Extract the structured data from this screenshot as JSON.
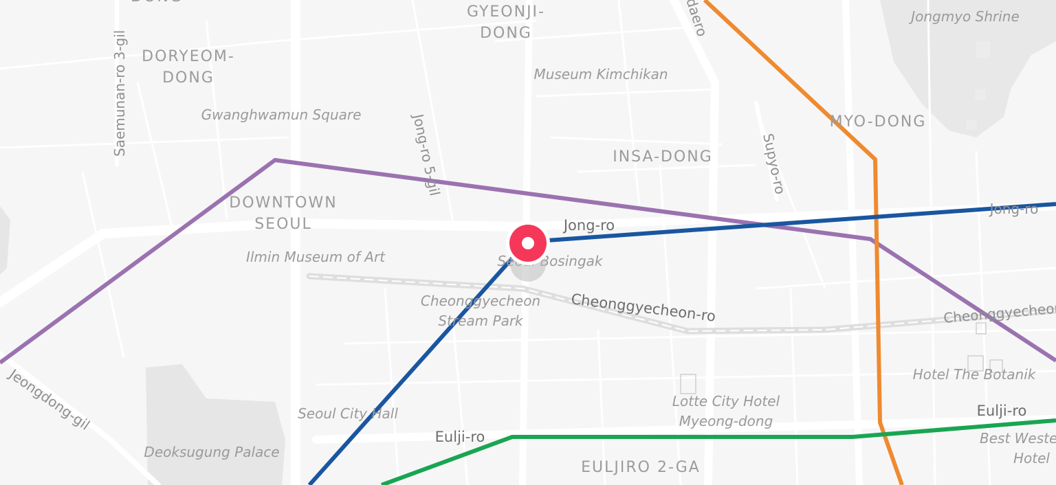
{
  "map": {
    "districts": {
      "gyeonji_1": "GYEONJI-",
      "gyeonji_2": "DONG",
      "doryeom_1": "DORYEOM-",
      "doryeom_2": "DONG",
      "downtown_1": "DOWNTOWN",
      "downtown_2": "SEOUL",
      "insa": "INSA-DONG",
      "myo": "MYO-DONG",
      "euljiro2ga": "EULJIRO 2-GA",
      "dong_top": "DONG"
    },
    "pois": {
      "jongmyo": "Jongmyo Shrine",
      "kimchikan": "Museum Kimchikan",
      "gwanghwamun": "Gwanghwamun Square",
      "ilmin": "Ilmin Museum of Art",
      "bosingak": "Seoul Bosingak",
      "cheonggye_1": "Cheonggyecheon",
      "cheonggye_2": "Stream Park",
      "botanik": "Hotel The Botanik",
      "lotte_1": "Lotte City Hotel",
      "lotte_2": "Myeong-dong",
      "cityhall": "Seoul City Hall",
      "deoksugung": "Deoksugung Palace",
      "bestwestern_1": "Best Western",
      "bestwestern_2": "Hotel"
    },
    "roads": {
      "saemunan": "Saemunan-ro 3-gil",
      "jongro5gil": "Jong-ro 5-gil",
      "supyo": "Supyo-ro",
      "daero": "daero",
      "jongro_main": "Jong-ro",
      "jongro_east": "Jong-ro",
      "cheonggye_ro": "Cheonggyecheon-ro",
      "cheonggye_ro_east": "Cheonggyecheon-ro",
      "eulji_west": "Eulji-ro",
      "eulji_east": "Eulji-ro",
      "jeongdong": "Jeongdong-gil"
    },
    "route_colors": {
      "purple": "#9b72b0",
      "blue": "#1a56a0",
      "orange": "#ef8a2f",
      "green": "#19a552",
      "marker": "#f5385a"
    }
  }
}
